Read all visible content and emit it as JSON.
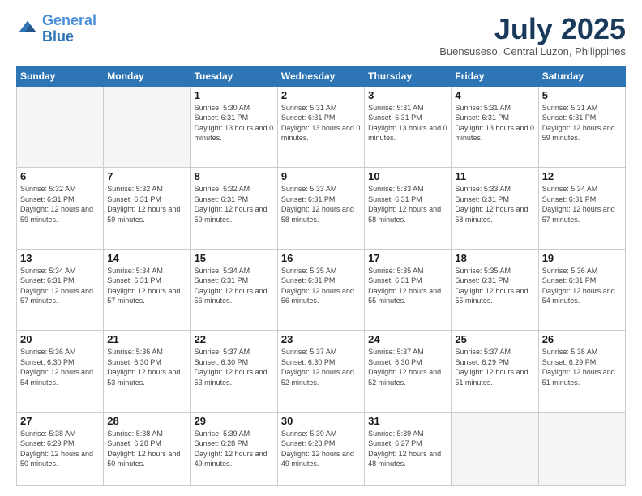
{
  "header": {
    "logo_line1": "General",
    "logo_line2": "Blue",
    "month_title": "July 2025",
    "subtitle": "Buensuseso, Central Luzon, Philippines"
  },
  "days_of_week": [
    "Sunday",
    "Monday",
    "Tuesday",
    "Wednesday",
    "Thursday",
    "Friday",
    "Saturday"
  ],
  "weeks": [
    [
      {
        "day": "",
        "info": ""
      },
      {
        "day": "",
        "info": ""
      },
      {
        "day": "1",
        "info": "Sunrise: 5:30 AM\nSunset: 6:31 PM\nDaylight: 13 hours\nand 0 minutes."
      },
      {
        "day": "2",
        "info": "Sunrise: 5:31 AM\nSunset: 6:31 PM\nDaylight: 13 hours\nand 0 minutes."
      },
      {
        "day": "3",
        "info": "Sunrise: 5:31 AM\nSunset: 6:31 PM\nDaylight: 13 hours\nand 0 minutes."
      },
      {
        "day": "4",
        "info": "Sunrise: 5:31 AM\nSunset: 6:31 PM\nDaylight: 13 hours\nand 0 minutes."
      },
      {
        "day": "5",
        "info": "Sunrise: 5:31 AM\nSunset: 6:31 PM\nDaylight: 12 hours\nand 59 minutes."
      }
    ],
    [
      {
        "day": "6",
        "info": "Sunrise: 5:32 AM\nSunset: 6:31 PM\nDaylight: 12 hours\nand 59 minutes."
      },
      {
        "day": "7",
        "info": "Sunrise: 5:32 AM\nSunset: 6:31 PM\nDaylight: 12 hours\nand 59 minutes."
      },
      {
        "day": "8",
        "info": "Sunrise: 5:32 AM\nSunset: 6:31 PM\nDaylight: 12 hours\nand 59 minutes."
      },
      {
        "day": "9",
        "info": "Sunrise: 5:33 AM\nSunset: 6:31 PM\nDaylight: 12 hours\nand 58 minutes."
      },
      {
        "day": "10",
        "info": "Sunrise: 5:33 AM\nSunset: 6:31 PM\nDaylight: 12 hours\nand 58 minutes."
      },
      {
        "day": "11",
        "info": "Sunrise: 5:33 AM\nSunset: 6:31 PM\nDaylight: 12 hours\nand 58 minutes."
      },
      {
        "day": "12",
        "info": "Sunrise: 5:34 AM\nSunset: 6:31 PM\nDaylight: 12 hours\nand 57 minutes."
      }
    ],
    [
      {
        "day": "13",
        "info": "Sunrise: 5:34 AM\nSunset: 6:31 PM\nDaylight: 12 hours\nand 57 minutes."
      },
      {
        "day": "14",
        "info": "Sunrise: 5:34 AM\nSunset: 6:31 PM\nDaylight: 12 hours\nand 57 minutes."
      },
      {
        "day": "15",
        "info": "Sunrise: 5:34 AM\nSunset: 6:31 PM\nDaylight: 12 hours\nand 56 minutes."
      },
      {
        "day": "16",
        "info": "Sunrise: 5:35 AM\nSunset: 6:31 PM\nDaylight: 12 hours\nand 56 minutes."
      },
      {
        "day": "17",
        "info": "Sunrise: 5:35 AM\nSunset: 6:31 PM\nDaylight: 12 hours\nand 55 minutes."
      },
      {
        "day": "18",
        "info": "Sunrise: 5:35 AM\nSunset: 6:31 PM\nDaylight: 12 hours\nand 55 minutes."
      },
      {
        "day": "19",
        "info": "Sunrise: 5:36 AM\nSunset: 6:31 PM\nDaylight: 12 hours\nand 54 minutes."
      }
    ],
    [
      {
        "day": "20",
        "info": "Sunrise: 5:36 AM\nSunset: 6:30 PM\nDaylight: 12 hours\nand 54 minutes."
      },
      {
        "day": "21",
        "info": "Sunrise: 5:36 AM\nSunset: 6:30 PM\nDaylight: 12 hours\nand 53 minutes."
      },
      {
        "day": "22",
        "info": "Sunrise: 5:37 AM\nSunset: 6:30 PM\nDaylight: 12 hours\nand 53 minutes."
      },
      {
        "day": "23",
        "info": "Sunrise: 5:37 AM\nSunset: 6:30 PM\nDaylight: 12 hours\nand 52 minutes."
      },
      {
        "day": "24",
        "info": "Sunrise: 5:37 AM\nSunset: 6:30 PM\nDaylight: 12 hours\nand 52 minutes."
      },
      {
        "day": "25",
        "info": "Sunrise: 5:37 AM\nSunset: 6:29 PM\nDaylight: 12 hours\nand 51 minutes."
      },
      {
        "day": "26",
        "info": "Sunrise: 5:38 AM\nSunset: 6:29 PM\nDaylight: 12 hours\nand 51 minutes."
      }
    ],
    [
      {
        "day": "27",
        "info": "Sunrise: 5:38 AM\nSunset: 6:29 PM\nDaylight: 12 hours\nand 50 minutes."
      },
      {
        "day": "28",
        "info": "Sunrise: 5:38 AM\nSunset: 6:28 PM\nDaylight: 12 hours\nand 50 minutes."
      },
      {
        "day": "29",
        "info": "Sunrise: 5:39 AM\nSunset: 6:28 PM\nDaylight: 12 hours\nand 49 minutes."
      },
      {
        "day": "30",
        "info": "Sunrise: 5:39 AM\nSunset: 6:28 PM\nDaylight: 12 hours\nand 49 minutes."
      },
      {
        "day": "31",
        "info": "Sunrise: 5:39 AM\nSunset: 6:27 PM\nDaylight: 12 hours\nand 48 minutes."
      },
      {
        "day": "",
        "info": ""
      },
      {
        "day": "",
        "info": ""
      }
    ]
  ]
}
